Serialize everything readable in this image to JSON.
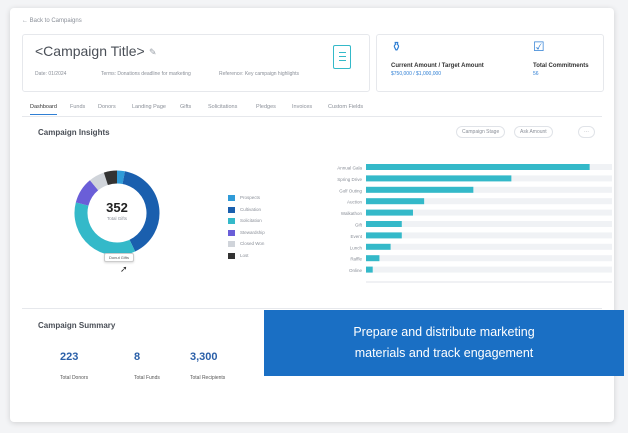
{
  "nav": {
    "back_label": "← Back to Campaigns"
  },
  "header": {
    "title": "<Campaign Title>",
    "meta_1": "Date: 01/2024",
    "meta_2": "Terms: Donations deadline for marketing",
    "meta_3": "Reference: Key campaign highlights",
    "amount_label": "Current Amount / Target Amount",
    "amount_value": "$750,000 / $1,000,000",
    "commitment_label": "Total Commitments",
    "commitment_value": "56"
  },
  "tabs": [
    "Dashboard",
    "Funds",
    "Donors",
    "Landing Page",
    "Gifts",
    "Solicitations",
    "Pledges",
    "Invoices",
    "Custom Fields"
  ],
  "insights": {
    "title": "Campaign Insights",
    "filter_1": "Campaign Stage",
    "filter_2": "Ask Amount",
    "total": "352",
    "total_label": "Total Gifts",
    "tooltip": "Donut Gifts",
    "legend": [
      {
        "label": "Prospects",
        "color": "#2f9bd8"
      },
      {
        "label": "Cultivation",
        "color": "#1a5fae"
      },
      {
        "label": "Solicitation",
        "color": "#34b9c9"
      },
      {
        "label": "Stewardship",
        "color": "#6a5ed8"
      },
      {
        "label": "Closed Won",
        "color": "#d0d4da"
      },
      {
        "label": "Lost",
        "color": "#333333"
      }
    ]
  },
  "chart_data": [
    {
      "type": "pie",
      "values": [
        3,
        40,
        36,
        10,
        6,
        5
      ],
      "colors": [
        "#2f9bd8",
        "#1a5fae",
        "#34b9c9",
        "#6a5ed8",
        "#d0d4da",
        "#333333"
      ]
    },
    {
      "type": "bar",
      "categories": [
        "Annual Gala",
        "Spring Drive",
        "Golf Outing",
        "Auction",
        "Walkathon",
        "Gift",
        "Event",
        "Lunch",
        "Raffle",
        "Online"
      ],
      "values": [
        100,
        65,
        48,
        26,
        21,
        16,
        16,
        11,
        6,
        3
      ],
      "ylim": [
        0,
        110
      ],
      "color": "#34b9c9"
    }
  ],
  "summary": {
    "title": "Campaign Summary",
    "items": [
      {
        "value": "223",
        "label": "Total Donors"
      },
      {
        "value": "8",
        "label": "Total Funds"
      },
      {
        "value": "3,300",
        "label": "Total Recipients"
      }
    ]
  },
  "overlay": {
    "line_1": "Prepare and distribute marketing",
    "line_2": "materials and track engagement"
  }
}
